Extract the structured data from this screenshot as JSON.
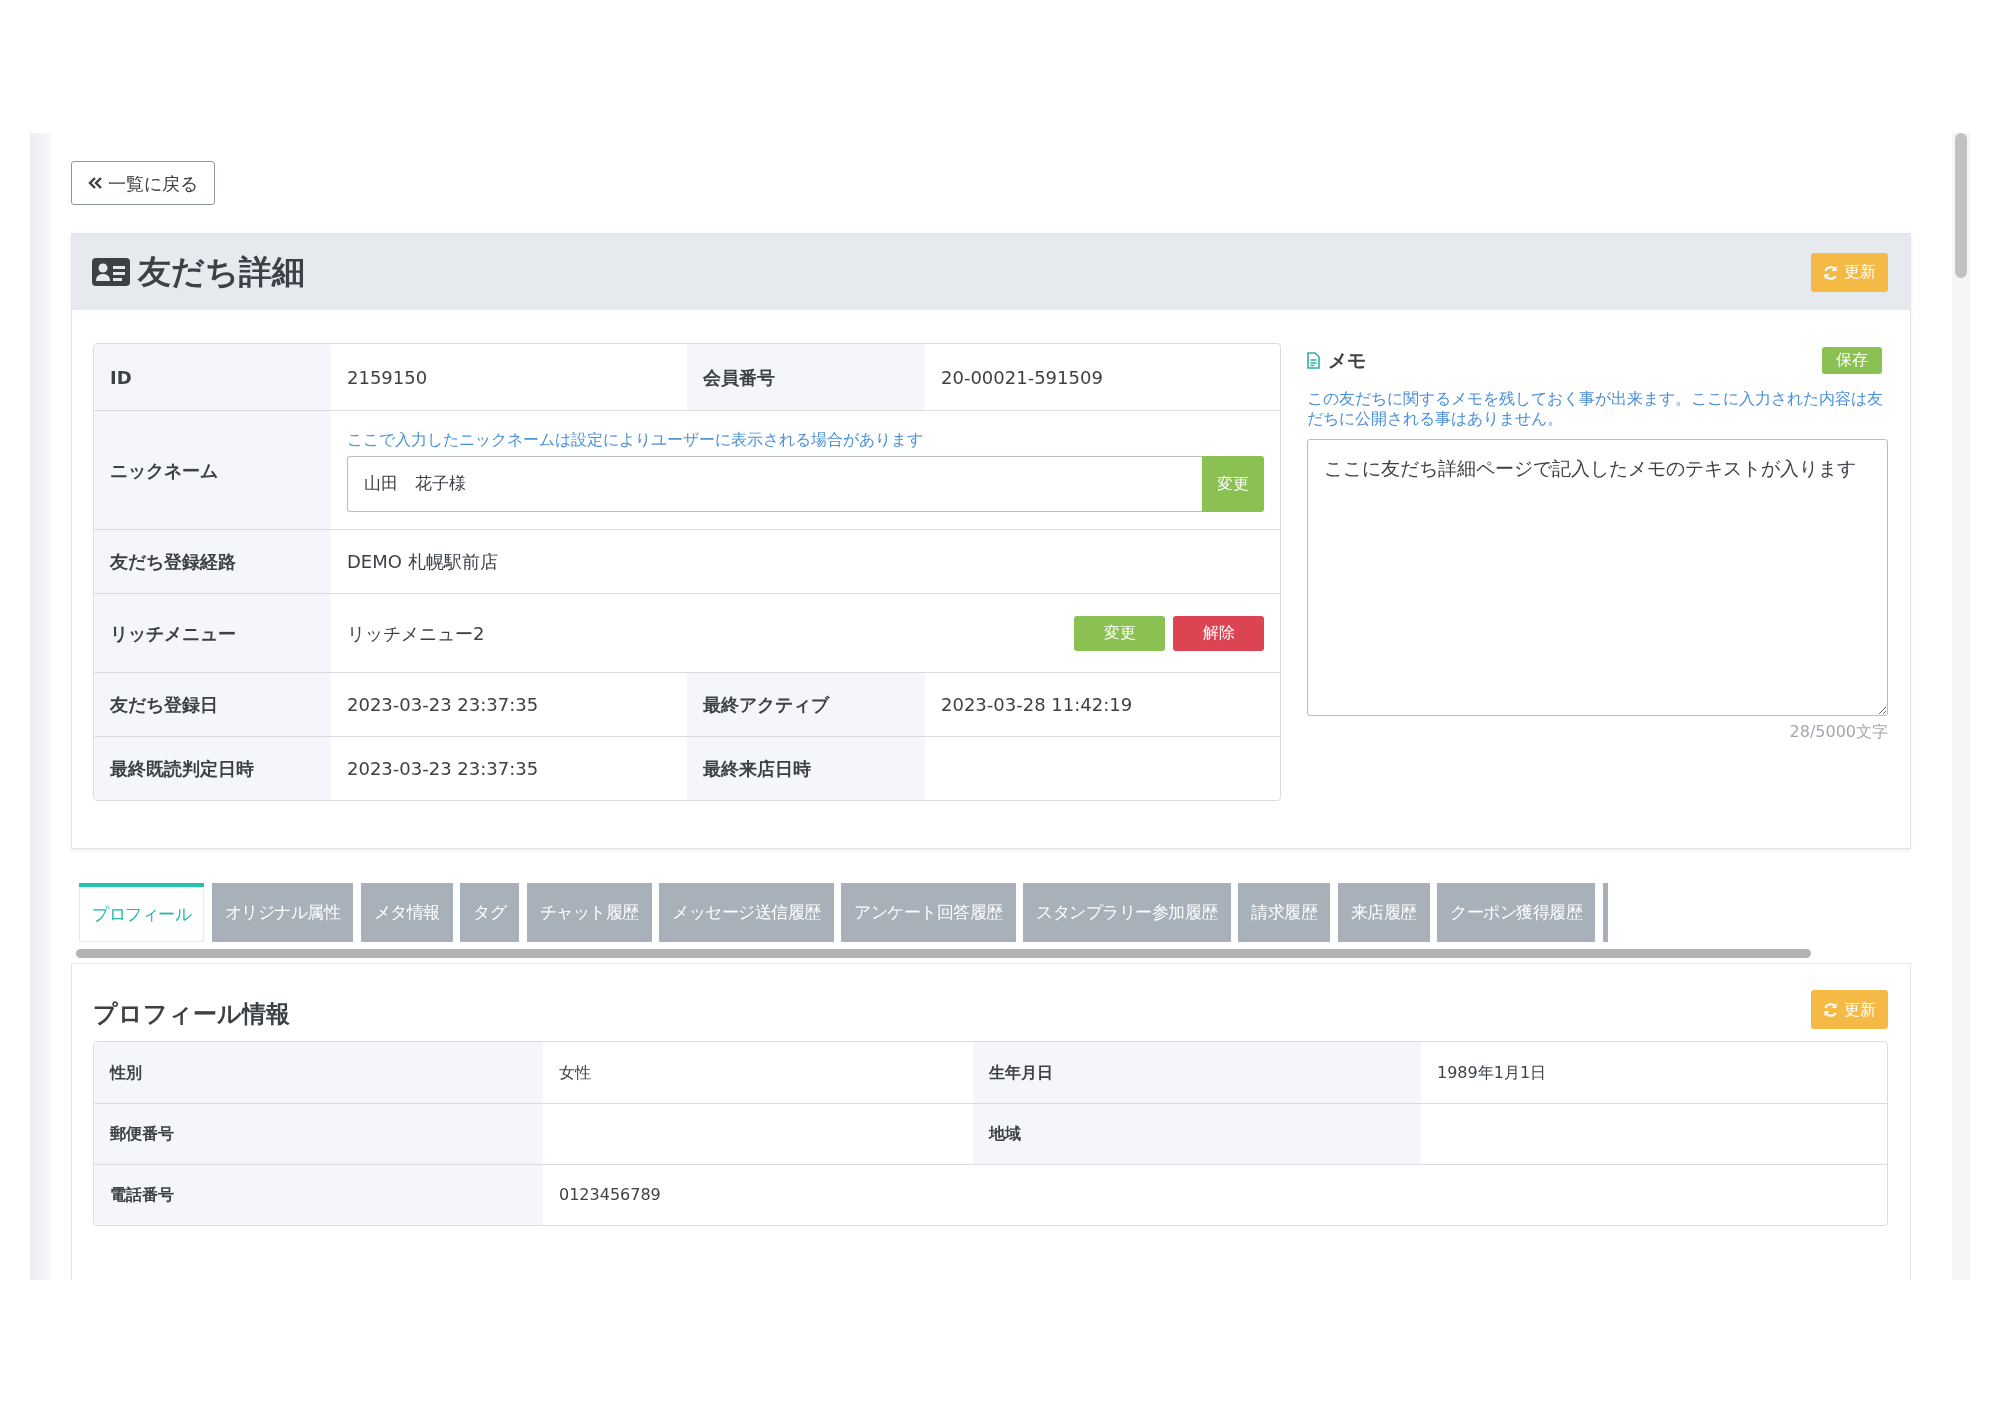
{
  "back_button": {
    "label": "一覧に戻る"
  },
  "header": {
    "title": "友だち詳細",
    "refresh_button": "更新"
  },
  "details": {
    "rows": [
      {
        "kind": "pair",
        "cells": [
          {
            "label": "ID",
            "value": "2159150"
          },
          {
            "label": "会員番号",
            "value": "20-00021-591509"
          }
        ]
      },
      {
        "kind": "input",
        "label": "ニックネーム",
        "hint": "ここで入力したニックネームは設定によりユーザーに表示される場合があります",
        "value": "山田　花子様",
        "button": "変更"
      },
      {
        "kind": "text",
        "label": "友だち登録経路",
        "value": "DEMO 札幌駅前店"
      },
      {
        "kind": "actions",
        "label": "リッチメニュー",
        "value": "リッチメニュー2",
        "buttons": [
          {
            "label": "変更",
            "kind": "change"
          },
          {
            "label": "解除",
            "kind": "remove"
          }
        ]
      },
      {
        "kind": "pair",
        "cells": [
          {
            "label": "友だち登録日",
            "value": "2023-03-23 23:37:35"
          },
          {
            "label": "最終アクティブ",
            "value": "2023-03-28 11:42:19"
          }
        ]
      },
      {
        "kind": "pair",
        "cells": [
          {
            "label": "最終既読判定日時",
            "value": "2023-03-23 23:37:35"
          },
          {
            "label": "最終来店日時"
          }
        ]
      }
    ]
  },
  "memo": {
    "title": "メモ",
    "save_button": "保存",
    "description": "この友だちに関するメモを残しておく事が出来ます。ここに入力された内容は友だちに公開される事はありません。",
    "text": "ここに友だち詳細ページで記入したメモのテキストが入ります",
    "counter": "28/5000文字"
  },
  "tabs": [
    {
      "label": "プロフィール",
      "selected": true
    },
    {
      "label": "オリジナル属性",
      "selected": false
    },
    {
      "label": "メタ情報",
      "selected": false
    },
    {
      "label": "タグ",
      "selected": false
    },
    {
      "label": "チャット履歴",
      "selected": false
    },
    {
      "label": "メッセージ送信履歴",
      "selected": false
    },
    {
      "label": "アンケート回答履歴",
      "selected": false
    },
    {
      "label": "スタンプラリー参加履歴",
      "selected": false
    },
    {
      "label": "請求履歴",
      "selected": false
    },
    {
      "label": "来店履歴",
      "selected": false
    },
    {
      "label": "クーポン獲得履歴",
      "selected": false
    }
  ],
  "profile": {
    "title": "プロフィール情報",
    "refresh_button": "更新",
    "rows": [
      [
        {
          "label": "性別",
          "value": "女性"
        },
        {
          "label": "生年月日",
          "value": "1989年1月1日"
        }
      ],
      [
        {
          "label": "郵便番号"
        },
        {
          "label": "地域"
        }
      ],
      [
        {
          "label": "電話番号",
          "value": "0123456789"
        }
      ]
    ]
  }
}
